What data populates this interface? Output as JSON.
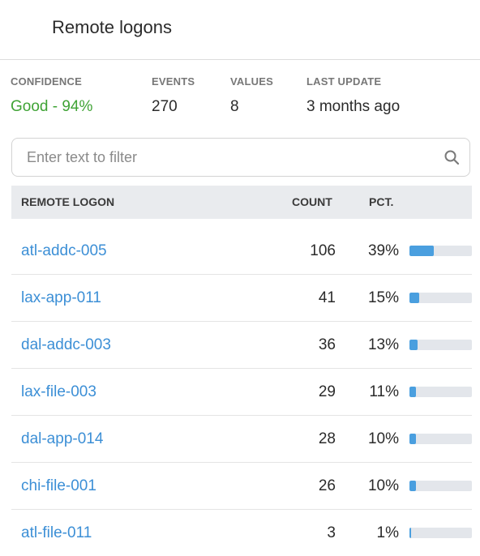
{
  "panel": {
    "title": "Remote logons"
  },
  "stats": {
    "confidence": {
      "label": "CONFIDENCE",
      "value": "Good - 94%"
    },
    "events": {
      "label": "EVENTS",
      "value": "270"
    },
    "values": {
      "label": "VALUES",
      "value": "8"
    },
    "last_update": {
      "label": "LAST UPDATE",
      "value": "3 months ago"
    }
  },
  "filter": {
    "placeholder": "Enter text to filter",
    "value": ""
  },
  "table": {
    "headers": {
      "name": "REMOTE LOGON",
      "count": "COUNT",
      "pct": "PCT."
    },
    "rows": [
      {
        "name": "atl-addc-005",
        "count": "106",
        "pct": "39%",
        "fraction": 0.39
      },
      {
        "name": "lax-app-011",
        "count": "41",
        "pct": "15%",
        "fraction": 0.15
      },
      {
        "name": "dal-addc-003",
        "count": "36",
        "pct": "13%",
        "fraction": 0.13
      },
      {
        "name": "lax-file-003",
        "count": "29",
        "pct": "11%",
        "fraction": 0.11
      },
      {
        "name": "dal-app-014",
        "count": "28",
        "pct": "10%",
        "fraction": 0.1
      },
      {
        "name": "chi-file-001",
        "count": "26",
        "pct": "10%",
        "fraction": 0.1
      },
      {
        "name": "atl-file-011",
        "count": "3",
        "pct": "1%",
        "fraction": 0.01
      }
    ]
  },
  "colors": {
    "accent_link": "#3c8fd6",
    "bar_fill": "#4a9fdf",
    "bar_track": "#e3e6eb",
    "good_status": "#3fa335"
  },
  "icons": {
    "search": "search-icon"
  }
}
